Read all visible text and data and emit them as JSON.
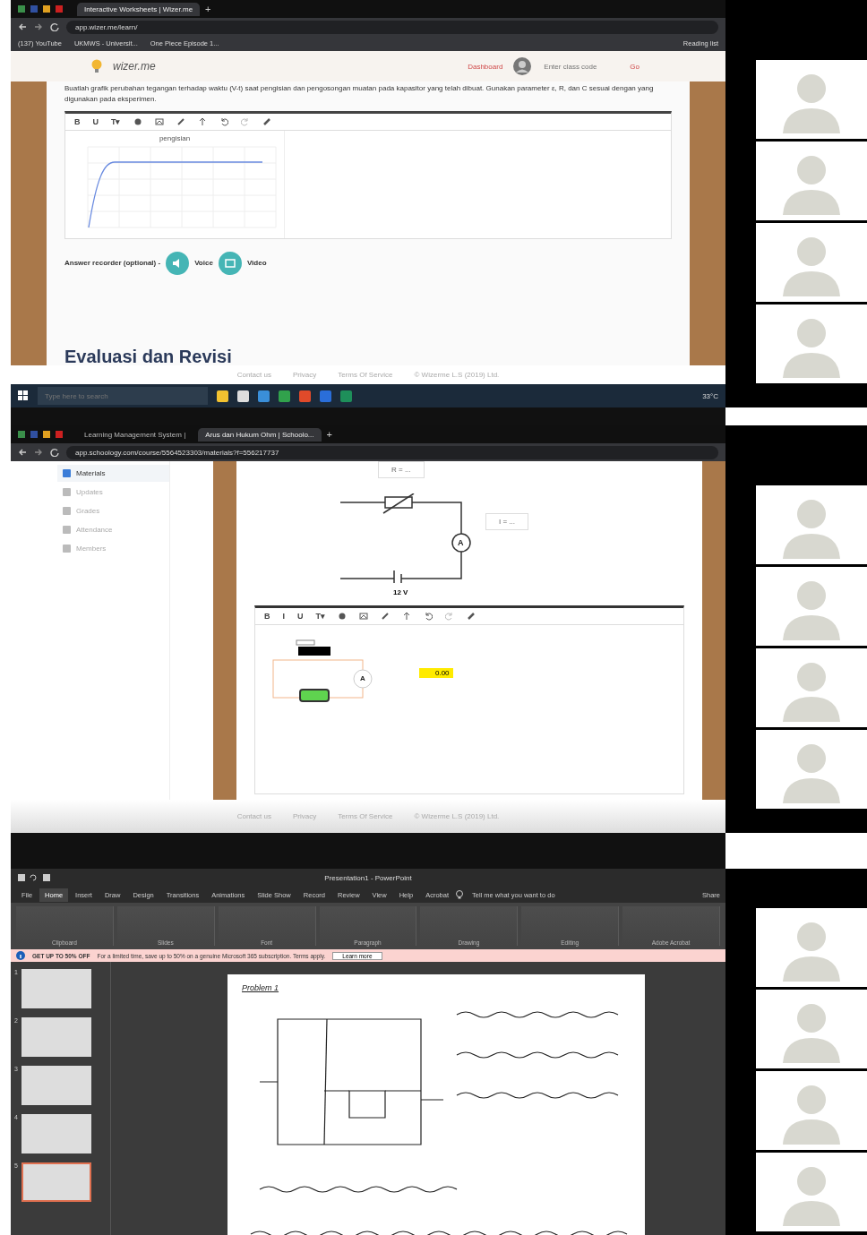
{
  "wizer": {
    "browser": {
      "tabs": [
        {
          "label": "Interactive Worksheets | Wizer.me",
          "selected": true
        }
      ],
      "new_tab": "+",
      "address": "app.wizer.me/learn/",
      "bookmarks": [
        "(137) YouTube",
        "UKMWS - Universit...",
        "One Piece Episode 1...",
        "Reading list"
      ]
    },
    "header": {
      "logo": "wizer.me",
      "dashboard": "Dashboard",
      "class_code_placeholder": "Enter class code",
      "go": "Go"
    },
    "instruction": "Buatlah grafik perubahan tegangan terhadap waktu (V-t) saat pengisian dan pengosongan muatan pada kapasitor yang telah dibuat. Gunakan parameter ε, R, dan C sesuai dengan yang digunakan pada eksperimen.",
    "toolbar": [
      "B",
      "U",
      "T▾"
    ],
    "chart_title": "pengisian",
    "recorder": {
      "label": "Answer recorder (optional) -",
      "voice": "Voice",
      "video": "Video"
    },
    "section_title": "Evaluasi dan Revisi",
    "footer": [
      "Contact us",
      "Privacy",
      "Terms Of Service",
      "© Wizerme L.S (2019) Ltd."
    ],
    "taskbar": {
      "search_placeholder": "Type here to search",
      "weather": "33°C"
    }
  },
  "lms": {
    "browser": {
      "tabs": [
        {
          "label": "Learning Management System |",
          "selected": false
        },
        {
          "label": "Arus dan Hukum Ohm | Schoolo...",
          "selected": true
        }
      ],
      "new_tab": "+",
      "address": "app.schoology.com/course/5564523303/materials?f=556217737"
    },
    "sidebar": [
      {
        "label": "Materials",
        "selected": true
      },
      {
        "label": "Updates",
        "selected": false
      },
      {
        "label": "Grades",
        "selected": false
      },
      {
        "label": "Attendance",
        "selected": false
      },
      {
        "label": "Members",
        "selected": false
      }
    ],
    "circuit": {
      "ammeter_symbol": "A",
      "resistance_label": "R = ...",
      "current_label": "I = ...",
      "voltage": "12 V"
    },
    "toolbar": [
      "B",
      "I",
      "U",
      "T▾"
    ],
    "answer": {
      "ammeter_symbol": "A",
      "meter_reading": "0.00"
    },
    "footer": [
      "Contact us",
      "Privacy",
      "Terms Of Service",
      "© Wizerme L.S (2019) Ltd."
    ]
  },
  "ppt": {
    "title": "Presentation1 - PowerPoint",
    "ribbon_tabs": [
      {
        "label": "File",
        "selected": false
      },
      {
        "label": "Home",
        "selected": true
      },
      {
        "label": "Insert",
        "selected": false
      },
      {
        "label": "Draw",
        "selected": false
      },
      {
        "label": "Design",
        "selected": false
      },
      {
        "label": "Transitions",
        "selected": false
      },
      {
        "label": "Animations",
        "selected": false
      },
      {
        "label": "Slide Show",
        "selected": false
      },
      {
        "label": "Record",
        "selected": false
      },
      {
        "label": "Review",
        "selected": false
      },
      {
        "label": "View",
        "selected": false
      },
      {
        "label": "Help",
        "selected": false
      },
      {
        "label": "Acrobat",
        "selected": false
      }
    ],
    "tell_me": "Tell me what you want to do",
    "share": "Share",
    "ribbon_groups": [
      "Clipboard",
      "Slides",
      "Font",
      "Paragraph",
      "Drawing",
      "Editing",
      "Adobe Acrobat"
    ],
    "banner": {
      "title": "GET UP TO 50% OFF",
      "text": "For a limited time, save up to 50% on a genuine Microsoft 365 subscription. Terms apply.",
      "button": "Learn more"
    },
    "thumbnails": [
      {
        "number": "1",
        "selected": false
      },
      {
        "number": "2",
        "selected": false
      },
      {
        "number": "3",
        "selected": false
      },
      {
        "number": "4",
        "selected": false
      },
      {
        "number": "5",
        "selected": true
      }
    ],
    "slide_heading": "Problem 1"
  }
}
